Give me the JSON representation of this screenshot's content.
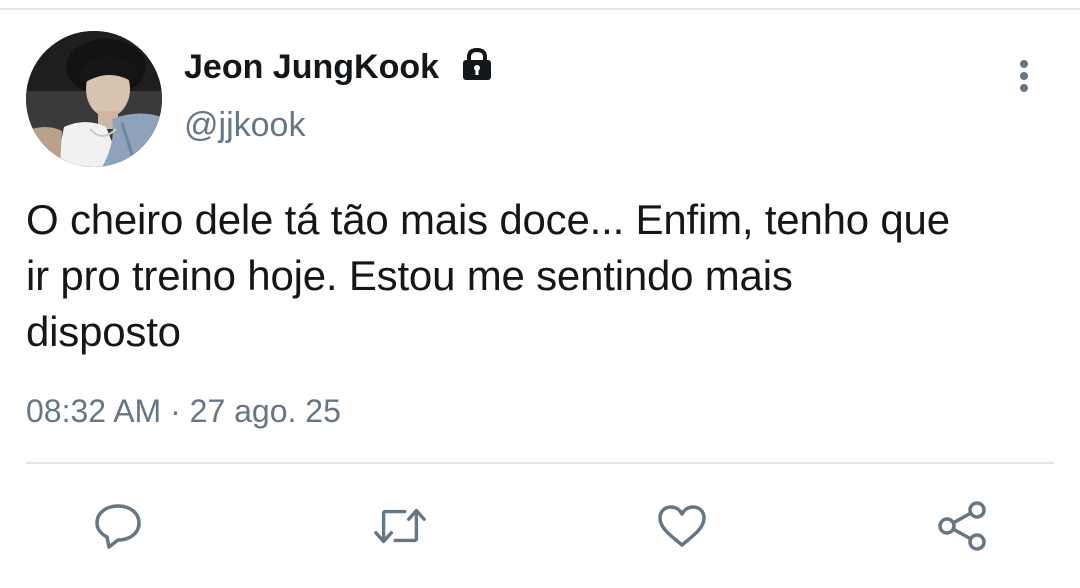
{
  "tweet": {
    "author": {
      "display_name": "Jeon JungKook",
      "handle": "@jjkook",
      "protected_icon": "lock-icon",
      "avatar_icon": "profile-photo"
    },
    "text_lines": [
      "O cheiro dele tá tão mais doce... Enfim, tenho que",
      "ir pro treino hoje. Estou me sentindo mais",
      "disposto"
    ],
    "time": "08:32 AM",
    "separator": "·",
    "date": "27 ago. 25",
    "more_icon": "more-vertical-icon"
  },
  "actions": [
    {
      "name": "reply",
      "icon": "reply-icon"
    },
    {
      "name": "retweet",
      "icon": "retweet-icon"
    },
    {
      "name": "like",
      "icon": "heart-icon"
    },
    {
      "name": "share",
      "icon": "share-icon"
    }
  ],
  "colors": {
    "text": "#14171a",
    "secondary": "#657786",
    "divider": "#e1e4e8",
    "icon": "#657786"
  }
}
